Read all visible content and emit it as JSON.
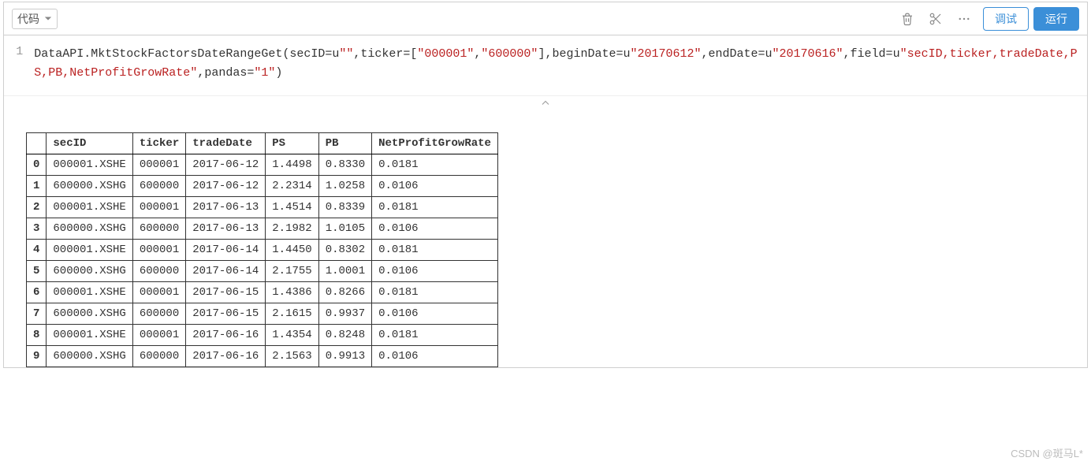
{
  "toolbar": {
    "celltype_label": "代码",
    "debug_label": "调试",
    "run_label": "运行"
  },
  "code": {
    "line_number": "1",
    "seg1": "DataAPI.MktStockFactorsDateRangeGet(secID=",
    "str_empty_pref": "u",
    "str_empty": "\"\"",
    "seg2": ",ticker=[",
    "str_t1": "\"000001\"",
    "seg3": ",",
    "str_t2": "\"600000\"",
    "seg4": "],beginDate=",
    "str_bd_pref": "u",
    "str_bd": "\"20170612\"",
    "seg5": ",endDate=",
    "str_ed_pref": "u",
    "str_ed": "\"20170616\"",
    "seg6": ",field=",
    "str_fld_pref": "u",
    "str_fld": "\"secID,ticker,tradeDate,PS,PB,NetProfitGrowRate\"",
    "seg7": ",pandas=",
    "str_pd": "\"1\"",
    "seg8": ")"
  },
  "table": {
    "columns": [
      "secID",
      "ticker",
      "tradeDate",
      "PS",
      "PB",
      "NetProfitGrowRate"
    ],
    "rows": [
      {
        "idx": "0",
        "cells": [
          "000001.XSHE",
          "000001",
          "2017-06-12",
          "1.4498",
          "0.8330",
          "0.0181"
        ]
      },
      {
        "idx": "1",
        "cells": [
          "600000.XSHG",
          "600000",
          "2017-06-12",
          "2.2314",
          "1.0258",
          "0.0106"
        ]
      },
      {
        "idx": "2",
        "cells": [
          "000001.XSHE",
          "000001",
          "2017-06-13",
          "1.4514",
          "0.8339",
          "0.0181"
        ]
      },
      {
        "idx": "3",
        "cells": [
          "600000.XSHG",
          "600000",
          "2017-06-13",
          "2.1982",
          "1.0105",
          "0.0106"
        ]
      },
      {
        "idx": "4",
        "cells": [
          "000001.XSHE",
          "000001",
          "2017-06-14",
          "1.4450",
          "0.8302",
          "0.0181"
        ]
      },
      {
        "idx": "5",
        "cells": [
          "600000.XSHG",
          "600000",
          "2017-06-14",
          "2.1755",
          "1.0001",
          "0.0106"
        ]
      },
      {
        "idx": "6",
        "cells": [
          "000001.XSHE",
          "000001",
          "2017-06-15",
          "1.4386",
          "0.8266",
          "0.0181"
        ]
      },
      {
        "idx": "7",
        "cells": [
          "600000.XSHG",
          "600000",
          "2017-06-15",
          "2.1615",
          "0.9937",
          "0.0106"
        ]
      },
      {
        "idx": "8",
        "cells": [
          "000001.XSHE",
          "000001",
          "2017-06-16",
          "1.4354",
          "0.8248",
          "0.0181"
        ]
      },
      {
        "idx": "9",
        "cells": [
          "600000.XSHG",
          "600000",
          "2017-06-16",
          "2.1563",
          "0.9913",
          "0.0106"
        ]
      }
    ]
  },
  "watermark": "CSDN @斑马L*"
}
